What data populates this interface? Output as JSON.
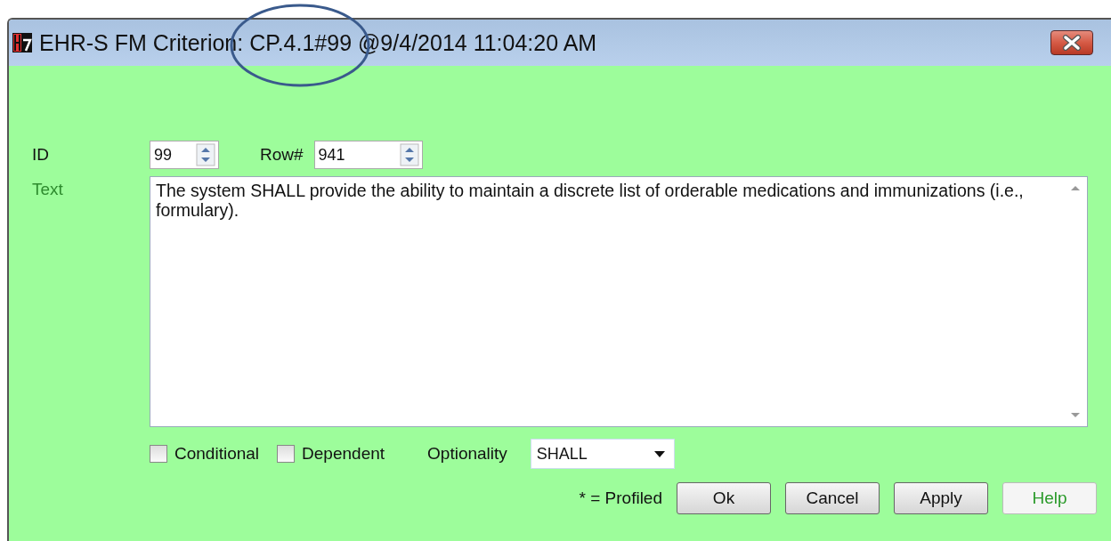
{
  "window": {
    "title": "EHR-S FM Criterion: CP.4.1#99 @9/4/2014 11:04:20 AM"
  },
  "id_field": {
    "label": "ID",
    "value": "99"
  },
  "row_field": {
    "label": "Row#",
    "value": "941"
  },
  "text_field": {
    "label": "Text",
    "color": "#2e8b2e",
    "value": "The system SHALL provide the ability to maintain a discrete list of orderable medications and immunizations (i.e., formulary)."
  },
  "checkboxes": [
    {
      "label": "Conditional",
      "checked": false
    },
    {
      "label": "Dependent",
      "checked": false
    }
  ],
  "optionality": {
    "label": "Optionality",
    "value": "SHALL"
  },
  "legend": "* = Profiled",
  "buttons": [
    {
      "label": "Ok",
      "disabled": false
    },
    {
      "label": "Cancel",
      "disabled": false
    },
    {
      "label": "Apply",
      "disabled": false
    },
    {
      "label": "Help",
      "disabled": true
    }
  ]
}
